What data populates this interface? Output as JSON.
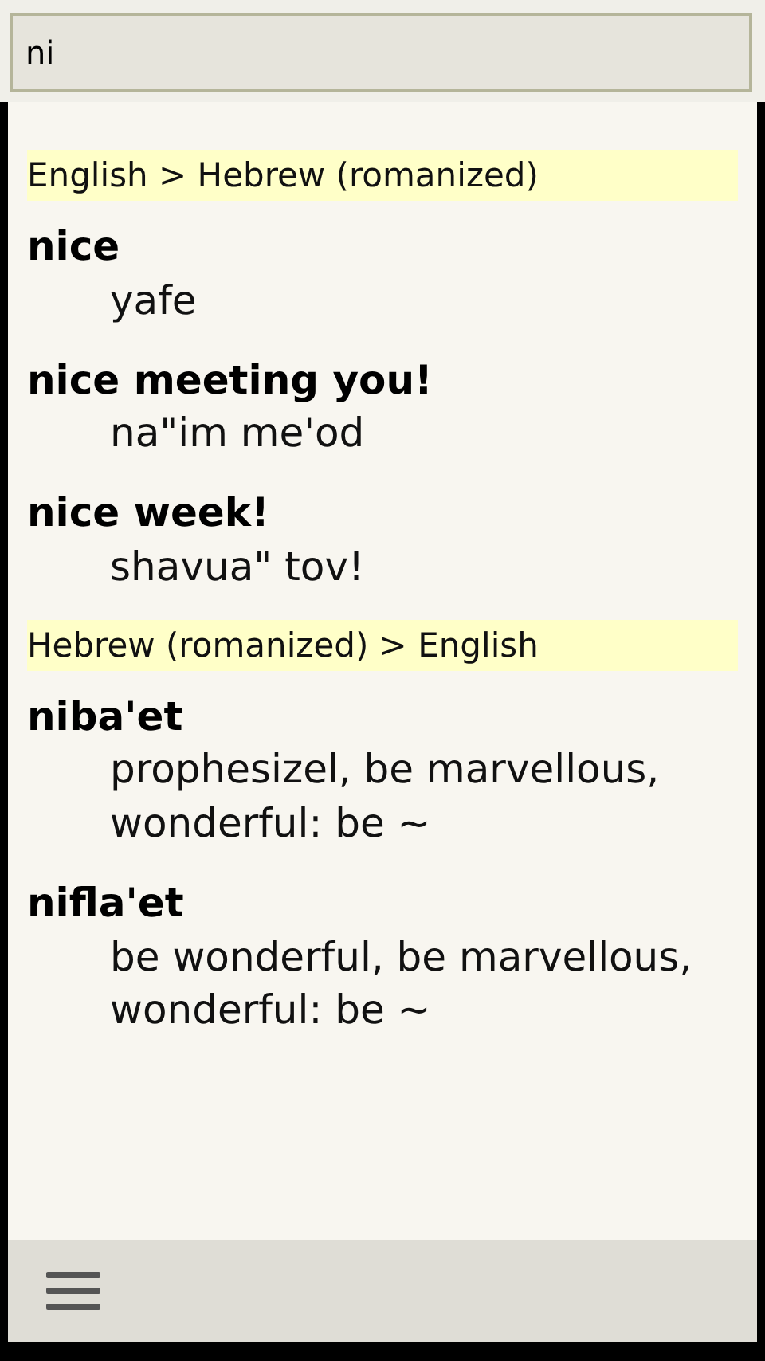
{
  "search": {
    "value": "ni"
  },
  "sections": [
    {
      "heading": "English > Hebrew (romanized)",
      "entries": [
        {
          "term": "nice",
          "translation": "yafe"
        },
        {
          "term": "nice meeting you!",
          "translation": "na\"im me'od"
        },
        {
          "term": "nice week!",
          "translation": "shavua\" tov!"
        }
      ]
    },
    {
      "heading": "Hebrew (romanized) > English",
      "entries": [
        {
          "term": "niba'et",
          "translation": "prophesizel, be marvellous, wonderful: be ~"
        },
        {
          "term": "nifla'et",
          "translation": "be wonderful, be marvellous, wonderful: be ~"
        }
      ]
    }
  ]
}
